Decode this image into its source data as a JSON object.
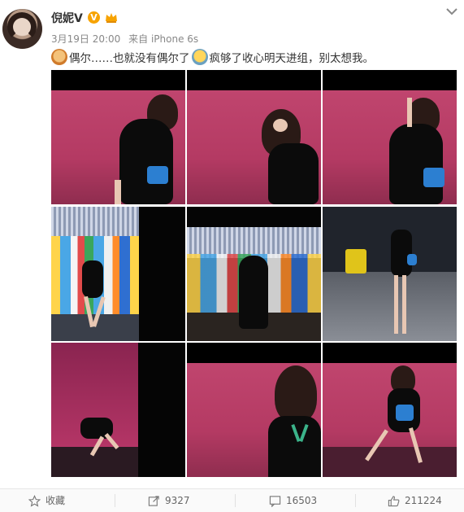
{
  "post": {
    "username": "倪妮V",
    "verified_badge": "V",
    "meta": {
      "date": "3月19日 20:00",
      "source": "来自 iPhone 6s"
    },
    "text_part1": "偶尔……也就没有偶尔了",
    "text_part2": "疯够了收心明天进组，别太想我。"
  },
  "photos_count": 9,
  "actions": {
    "favorite_label": "收藏",
    "repost_count": "9327",
    "comment_count": "16503",
    "like_count": "211224"
  },
  "icons": [
    "avatar",
    "vip-badge-icon",
    "verified-v-icon",
    "chevron-down-icon",
    "star-icon",
    "repost-icon",
    "comment-icon",
    "like-icon"
  ],
  "colors": {
    "accent_orange": "#f7a300",
    "text_primary": "#333333",
    "text_meta": "#888888"
  }
}
